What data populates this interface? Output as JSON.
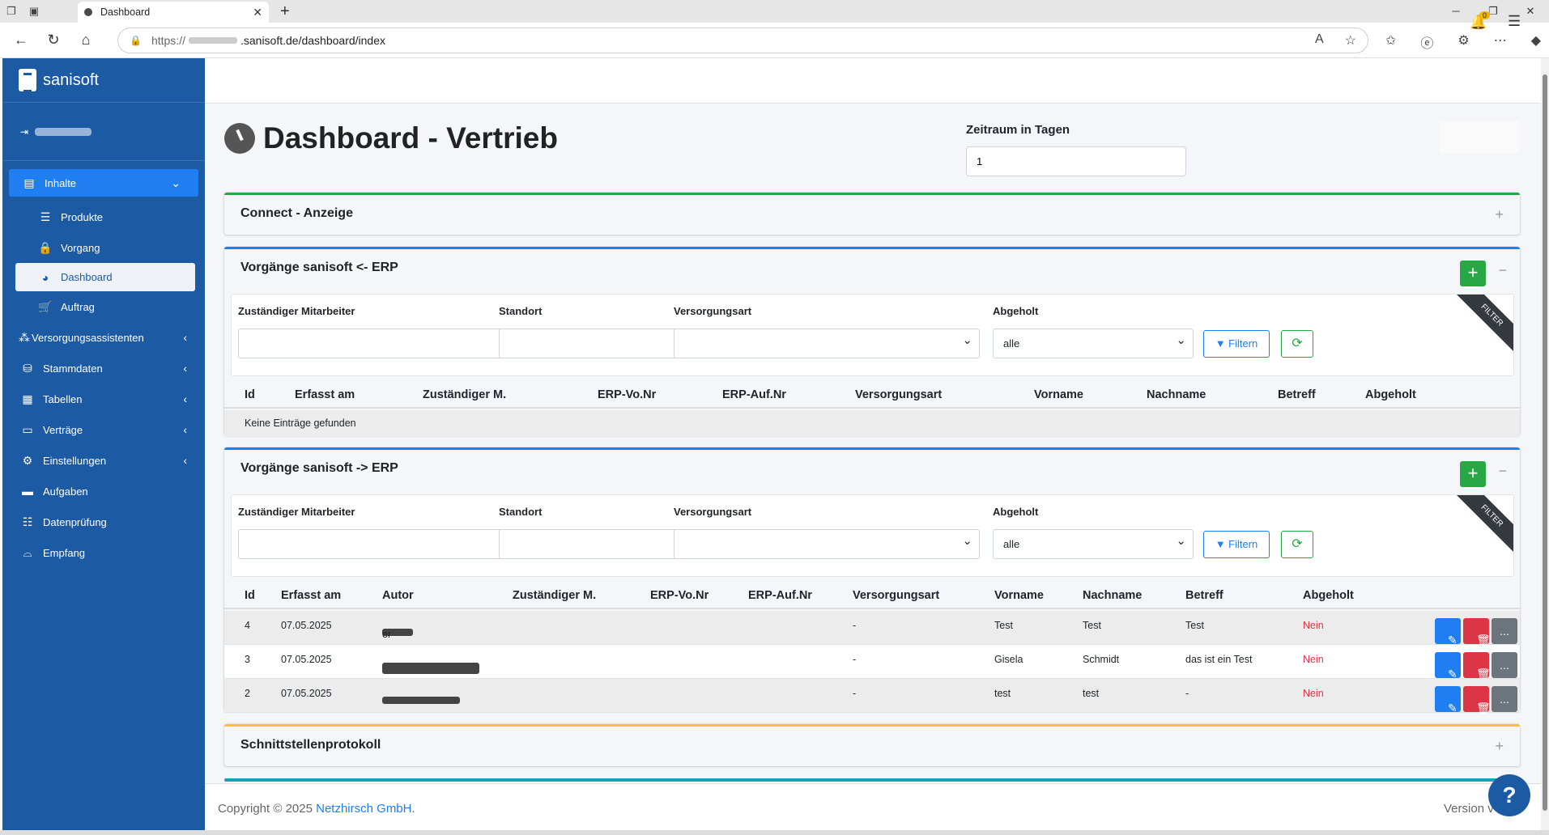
{
  "browser": {
    "tab_title": "Dashboard",
    "url_prefix": "https://",
    "url_domain": ".sanisoft.de/dashboard/index"
  },
  "sidebar": {
    "brand": "sanisoft",
    "items": [
      {
        "label": "Inhalte"
      },
      {
        "label": "Produkte"
      },
      {
        "label": "Vorgang"
      },
      {
        "label": "Dashboard"
      },
      {
        "label": "Auftrag"
      },
      {
        "label": "Versorgungsassistenten"
      },
      {
        "label": "Stammdaten"
      },
      {
        "label": "Tabellen"
      },
      {
        "label": "Verträge"
      },
      {
        "label": "Einstellungen"
      },
      {
        "label": "Aufgaben"
      },
      {
        "label": "Datenprüfung"
      },
      {
        "label": "Empfang"
      }
    ]
  },
  "topbar": {
    "notification_count": "0"
  },
  "page": {
    "title": "Dashboard - Vertrieb",
    "zeitraum_label": "Zeitraum in Tagen",
    "zeitraum_value": "1"
  },
  "cards": {
    "connect": {
      "title": "Connect - Anzeige"
    },
    "erp_in": {
      "title": "Vorgänge sanisoft <- ERP",
      "filters": {
        "mitarbeiter": "Zuständiger Mitarbeiter",
        "standort": "Standort",
        "versorgungsart": "Versorgungsart",
        "abgeholt": "Abgeholt",
        "abgeholt_value": "alle",
        "filter_button": "Filtern",
        "ribbon": "FILTER"
      },
      "columns": [
        "Id",
        "Erfasst am",
        "Zuständiger M.",
        "ERP-Vo.Nr",
        "ERP-Auf.Nr",
        "Versorgungsart",
        "Vorname",
        "Nachname",
        "Betreff",
        "Abgeholt"
      ],
      "empty": "Keine Einträge gefunden"
    },
    "erp_out": {
      "title": "Vorgänge sanisoft -> ERP",
      "filters": {
        "mitarbeiter": "Zuständiger Mitarbeiter",
        "standort": "Standort",
        "versorgungsart": "Versorgungsart",
        "abgeholt": "Abgeholt",
        "abgeholt_value": "alle",
        "filter_button": "Filtern",
        "ribbon": "FILTER"
      },
      "columns": [
        "Id",
        "Erfasst am",
        "Autor",
        "Zuständiger M.",
        "ERP-Vo.Nr",
        "ERP-Auf.Nr",
        "Versorgungsart",
        "Vorname",
        "Nachname",
        "Betreff",
        "Abgeholt"
      ],
      "rows": [
        {
          "id": "4",
          "date": "07.05.2025",
          "autor_tail": "er",
          "versorgungsart": "-",
          "vorname": "Test",
          "nachname": "Test",
          "betreff": "Test",
          "abgeholt": "Nein"
        },
        {
          "id": "3",
          "date": "07.05.2025",
          "autor_tail": "",
          "versorgungsart": "-",
          "vorname": "Gisela",
          "nachname": "Schmidt",
          "betreff": "das ist ein Test",
          "abgeholt": "Nein"
        },
        {
          "id": "2",
          "date": "07.05.2025",
          "autor_tail": "",
          "versorgungsart": "-",
          "vorname": "test",
          "nachname": "test",
          "betreff": "-",
          "abgeholt": "Nein"
        }
      ],
      "more_label": "..."
    },
    "protokoll": {
      "title": "Schnittstellenprotokoll"
    }
  },
  "footer": {
    "copyright": "Copyright © 2025 ",
    "company": "Netzhirsch GmbH",
    "period": ".",
    "version": "Version v"
  },
  "help": {
    "label": "?"
  },
  "colors": {
    "sidebar": "#1c5aa4",
    "accent": "#1e7ef2",
    "success": "#28a745",
    "danger": "#dc3545",
    "warning": "#f6c23e"
  }
}
